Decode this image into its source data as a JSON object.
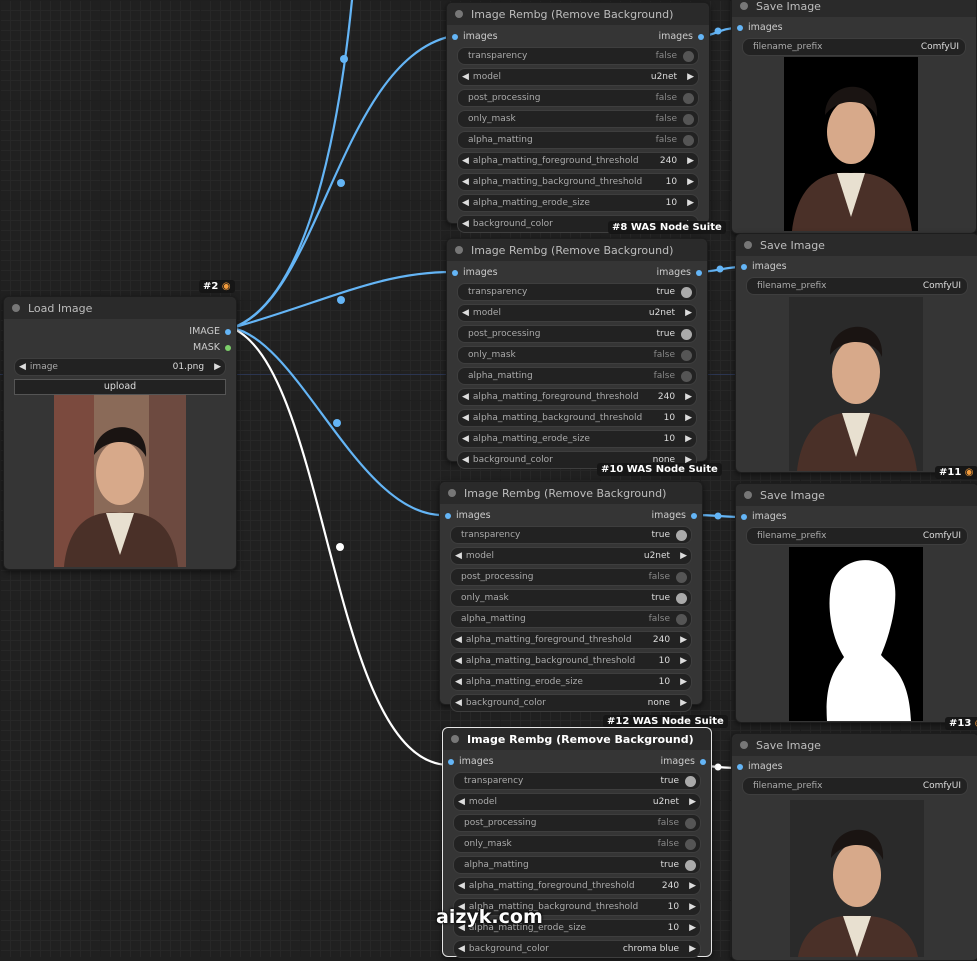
{
  "colors": {
    "wire_blue": "#64b5f6",
    "wire_white": "#ffffff",
    "canvas": "#202020",
    "node": "#353535",
    "badge_fox": "#f39c3c"
  },
  "load": {
    "title": "Load Image",
    "out_image": "IMAGE",
    "out_mask": "MASK",
    "image_label": "image",
    "image_value": "01.png",
    "upload": "upload",
    "id_badge": "#2"
  },
  "rembg": [
    {
      "title": "Image Rembg (Remove Background)",
      "in": "images",
      "out": "images",
      "badge": "#8 WAS Node Suite",
      "w": {
        "transparency": "false",
        "model": "u2net",
        "post_processing": "false",
        "only_mask": "false",
        "alpha_matting": "false",
        "fg": "240",
        "bg": "10",
        "erode": "10",
        "color": "none"
      }
    },
    {
      "title": "Image Rembg (Remove Background)",
      "in": "images",
      "out": "images",
      "badge": "#10 WAS Node Suite",
      "w": {
        "transparency": "true",
        "model": "u2net",
        "post_processing": "true",
        "only_mask": "false",
        "alpha_matting": "false",
        "fg": "240",
        "bg": "10",
        "erode": "10",
        "color": "none"
      }
    },
    {
      "title": "Image Rembg (Remove Background)",
      "in": "images",
      "out": "images",
      "badge": "#12 WAS Node Suite",
      "w": {
        "transparency": "true",
        "model": "u2net",
        "post_processing": "false",
        "only_mask": "true",
        "alpha_matting": "false",
        "fg": "240",
        "bg": "10",
        "erode": "10",
        "color": "none"
      }
    },
    {
      "title": "Image Rembg (Remove Background)",
      "in": "images",
      "out": "images",
      "badge": "",
      "w": {
        "transparency": "true",
        "model": "u2net",
        "post_processing": "false",
        "only_mask": "false",
        "alpha_matting": "true",
        "fg": "240",
        "bg": "10",
        "erode": "10",
        "color": "chroma blue"
      }
    }
  ],
  "labels": {
    "transparency": "transparency",
    "model": "model",
    "post_processing": "post_processing",
    "only_mask": "only_mask",
    "alpha_matting": "alpha_matting",
    "fg": "alpha_matting_foreground_threshold",
    "bg": "alpha_matting_background_threshold",
    "erode": "alpha_matting_erode_size",
    "color": "background_color"
  },
  "save": [
    {
      "title": "Save Image",
      "in": "images",
      "prefix_label": "filename_prefix",
      "prefix": "ComfyUI",
      "badge": ""
    },
    {
      "title": "Save Image",
      "in": "images",
      "prefix_label": "filename_prefix",
      "prefix": "ComfyUI",
      "badge": "#11"
    },
    {
      "title": "Save Image",
      "in": "images",
      "prefix_label": "filename_prefix",
      "prefix": "ComfyUI",
      "badge": "#13"
    },
    {
      "title": "Save Image",
      "in": "images",
      "prefix_label": "filename_prefix",
      "prefix": "ComfyUI",
      "badge": ""
    }
  ],
  "watermark": "aizyk.com"
}
